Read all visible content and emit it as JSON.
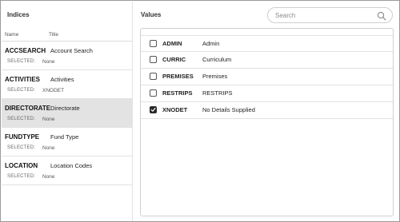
{
  "left_panel": {
    "title": "Indices",
    "columns": {
      "name": "Name",
      "title": "Title"
    },
    "selected_label": "SELECTED:",
    "items": [
      {
        "name": "ACCSEARCH",
        "title": "Account Search",
        "selected": "None"
      },
      {
        "name": "ACTIVITIES",
        "title": "Activities",
        "selected": "XNODET"
      },
      {
        "name": "DIRECTORATE",
        "title": "Directorate",
        "selected": "None"
      },
      {
        "name": "FUNDTYPE",
        "title": "Fund Type",
        "selected": "None"
      },
      {
        "name": "LOCATION",
        "title": "Location Codes",
        "selected": "None"
      }
    ],
    "highlighted_item": "DIRECTORATE"
  },
  "right_panel": {
    "title": "Values",
    "search": {
      "placeholder": "Search",
      "value": "",
      "icon": "search-icon"
    },
    "values": [
      {
        "code": "ADMIN",
        "description": "Admin",
        "checked": false
      },
      {
        "code": "CURRIC",
        "description": "Curriculum",
        "checked": false
      },
      {
        "code": "PREMISES",
        "description": "Premises",
        "checked": false
      },
      {
        "code": "RESTRIPS",
        "description": "RESTRIPS",
        "checked": false
      },
      {
        "code": "XNODET",
        "description": "No Details Supplied",
        "checked": true
      }
    ]
  },
  "colors": {
    "selected_row_bg": "#e3e3e3",
    "checkbox_checked": "#2a2a2a",
    "border": "#9a9a9a"
  }
}
